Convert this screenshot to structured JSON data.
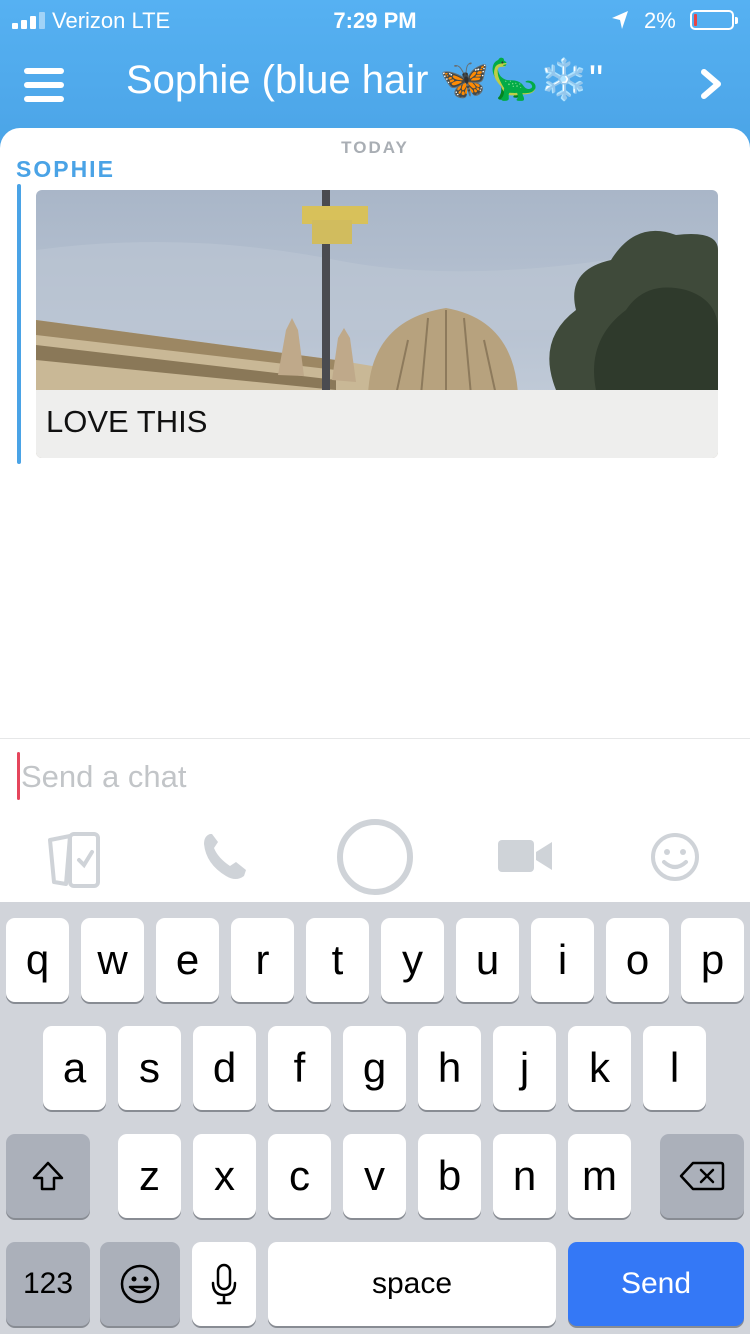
{
  "status_bar": {
    "carrier": "Verizon  LTE",
    "time": "7:29 PM",
    "battery_percent": "2%",
    "battery_level": 0.02,
    "icons": [
      "signal-icon",
      "location-arrow-icon",
      "battery-icon"
    ]
  },
  "header": {
    "title": "Sophie (blue hair 🦋🦕❄️\"",
    "menu_icon": "hamburger-menu-icon",
    "forward_icon": "chevron-right-icon"
  },
  "chat": {
    "date_label": "TODAY",
    "messages": [
      {
        "sender": "SOPHIE",
        "type": "snap",
        "caption": "LOVE THIS"
      }
    ]
  },
  "composer": {
    "placeholder": "Send a chat",
    "value": ""
  },
  "toolbar": {
    "items": [
      "memories-icon",
      "phone-icon",
      "capture-button",
      "video-camera-icon",
      "emoji-icon"
    ]
  },
  "keyboard": {
    "row1": [
      "q",
      "w",
      "e",
      "r",
      "t",
      "y",
      "u",
      "i",
      "o",
      "p"
    ],
    "row2": [
      "a",
      "s",
      "d",
      "f",
      "g",
      "h",
      "j",
      "k",
      "l"
    ],
    "row3": [
      "z",
      "x",
      "c",
      "v",
      "b",
      "n",
      "m"
    ],
    "numbers_label": "123",
    "space_label": "space",
    "send_label": "Send"
  },
  "colors": {
    "header_blue": "#4aa3e6",
    "sender_blue": "#4aa3e6",
    "send_key": "#3478f6",
    "cursor": "#e5465c",
    "battery_low": "#e84545"
  }
}
